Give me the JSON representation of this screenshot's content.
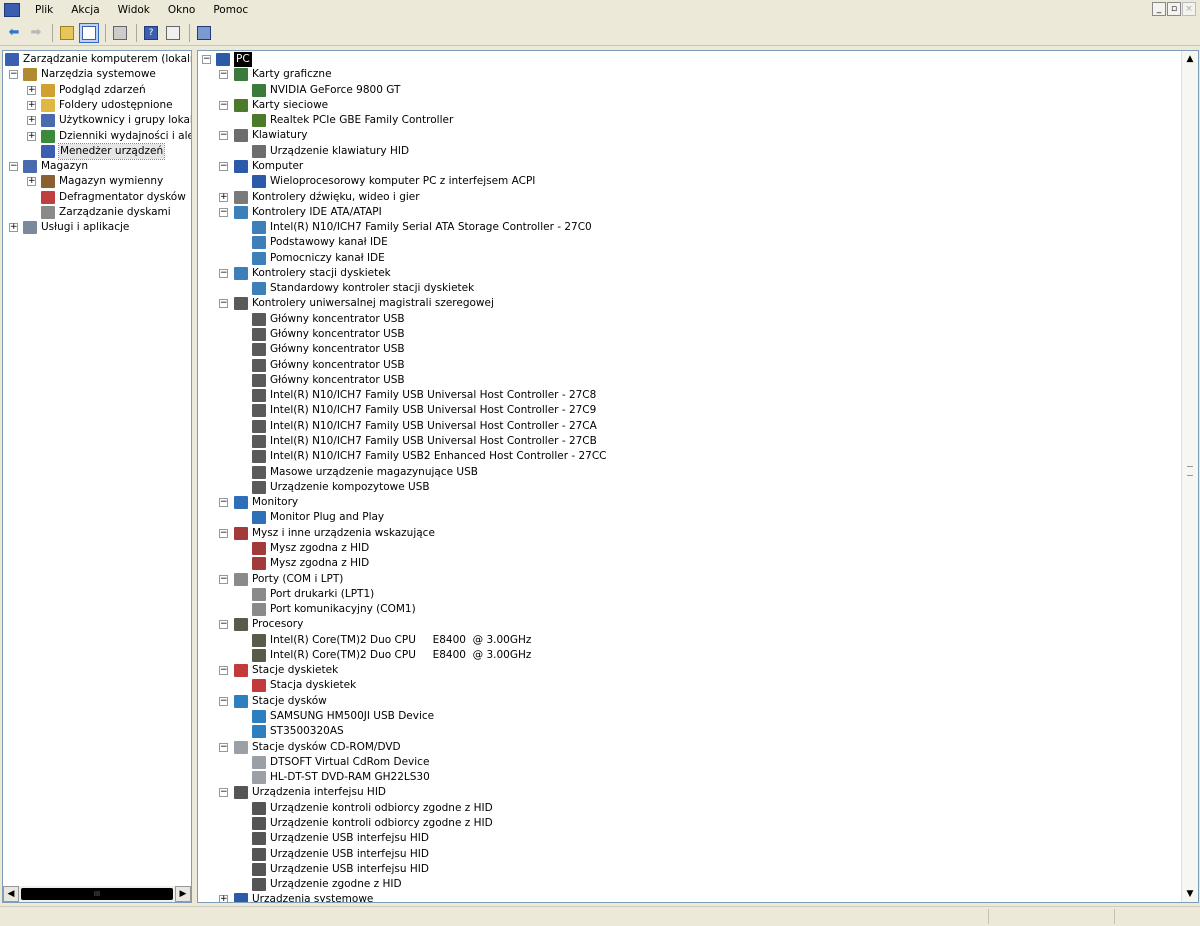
{
  "menubar": {
    "items": [
      "Plik",
      "Akcja",
      "Widok",
      "Okno",
      "Pomoc"
    ],
    "window_controls": [
      "_",
      "▫",
      "×"
    ]
  },
  "toolbar": {
    "buttons": [
      "arrow-left-icon",
      "arrow-right-icon",
      "up-folder-icon",
      "show-tree-icon",
      "print-icon",
      "help-icon",
      "view-icon",
      "properties-icon"
    ]
  },
  "left_tree": {
    "items": [
      {
        "label": "Zarządzanie komputerem (lokalne)",
        "level": 0,
        "icon": "computer-management-icon",
        "expander": ""
      },
      {
        "label": "Narzędzia systemowe",
        "level": 1,
        "icon": "tools-icon",
        "expander": "−"
      },
      {
        "label": "Podgląd zdarzeń",
        "level": 2,
        "icon": "event-viewer-icon",
        "expander": "+"
      },
      {
        "label": "Foldery udostępnione",
        "level": 2,
        "icon": "shared-folder-icon",
        "expander": "+"
      },
      {
        "label": "Użytkownicy i grupy lokalne",
        "level": 2,
        "icon": "users-icon",
        "expander": "+"
      },
      {
        "label": "Dzienniki wydajności i alerty",
        "level": 2,
        "icon": "performance-icon",
        "expander": "+"
      },
      {
        "label": "Menedżer urządzeń",
        "level": 2,
        "icon": "device-manager-icon",
        "expander": "",
        "selected": true
      },
      {
        "label": "Magazyn",
        "level": 1,
        "icon": "storage-icon",
        "expander": "−"
      },
      {
        "label": "Magazyn wymienny",
        "level": 2,
        "icon": "removable-storage-icon",
        "expander": "+"
      },
      {
        "label": "Defragmentator dysków",
        "level": 2,
        "icon": "defrag-icon",
        "expander": ""
      },
      {
        "label": "Zarządzanie dyskami",
        "level": 2,
        "icon": "disk-management-icon",
        "expander": ""
      },
      {
        "label": "Usługi i aplikacje",
        "level": 1,
        "icon": "services-icon",
        "expander": "+"
      }
    ],
    "scroll_thumb": "III"
  },
  "device_tree": {
    "root": "PC",
    "categories": [
      {
        "label": "Karty graficzne",
        "icon": "display-adapter-icon",
        "children": [
          "NVIDIA GeForce 9800 GT"
        ]
      },
      {
        "label": "Karty sieciowe",
        "icon": "network-adapter-icon",
        "children": [
          "Realtek PCIe GBE Family Controller"
        ]
      },
      {
        "label": "Klawiatury",
        "icon": "keyboard-icon",
        "children": [
          "Urządzenie klawiatury HID"
        ]
      },
      {
        "label": "Komputer",
        "icon": "computer-icon",
        "children": [
          "Wieloprocesorowy komputer PC z interfejsem ACPI"
        ]
      },
      {
        "label": "Kontrolery dźwięku, wideo i gier",
        "icon": "sound-icon",
        "children": []
      },
      {
        "label": "Kontrolery IDE ATA/ATAPI",
        "icon": "ide-controller-icon",
        "children": [
          "Intel(R) N10/ICH7 Family Serial ATA Storage Controller - 27C0",
          "Podstawowy kanał IDE",
          "Pomocniczy kanał IDE"
        ]
      },
      {
        "label": "Kontrolery stacji dyskietek",
        "icon": "floppy-controller-icon",
        "children": [
          "Standardowy kontroler stacji dyskietek"
        ]
      },
      {
        "label": "Kontrolery uniwersalnej magistrali szeregowej",
        "icon": "usb-icon",
        "children": [
          "Główny koncentrator USB",
          "Główny koncentrator USB",
          "Główny koncentrator USB",
          "Główny koncentrator USB",
          "Główny koncentrator USB",
          "Intel(R) N10/ICH7 Family USB Universal Host Controller - 27C8",
          "Intel(R) N10/ICH7 Family USB Universal Host Controller - 27C9",
          "Intel(R) N10/ICH7 Family USB Universal Host Controller - 27CA",
          "Intel(R) N10/ICH7 Family USB Universal Host Controller - 27CB",
          "Intel(R) N10/ICH7 Family USB2 Enhanced Host Controller - 27CC",
          "Masowe urządzenie magazynujące USB",
          "Urządzenie kompozytowe USB"
        ]
      },
      {
        "label": "Monitory",
        "icon": "monitor-icon",
        "children": [
          "Monitor Plug and Play"
        ]
      },
      {
        "label": "Mysz i inne urządzenia wskazujące",
        "icon": "mouse-icon",
        "children": [
          "Mysz zgodna z HID",
          "Mysz zgodna z HID"
        ]
      },
      {
        "label": "Porty (COM i LPT)",
        "icon": "port-icon",
        "children": [
          "Port drukarki (LPT1)",
          "Port komunikacyjny (COM1)"
        ]
      },
      {
        "label": "Procesory",
        "icon": "processor-icon",
        "children": [
          "Intel(R) Core(TM)2 Duo CPU     E8400  @ 3.00GHz",
          "Intel(R) Core(TM)2 Duo CPU     E8400  @ 3.00GHz"
        ]
      },
      {
        "label": "Stacje dyskietek",
        "icon": "floppy-drive-icon",
        "children": [
          "Stacja dyskietek"
        ]
      },
      {
        "label": "Stacje dysków",
        "icon": "disk-drive-icon",
        "children": [
          "SAMSUNG HM500JI USB Device",
          "ST3500320AS"
        ]
      },
      {
        "label": "Stacje dysków CD-ROM/DVD",
        "icon": "cdrom-icon",
        "children": [
          "DTSOFT Virtual CdRom Device",
          "HL-DT-ST DVD-RAM GH22LS30"
        ]
      },
      {
        "label": "Urządzenia interfejsu HID",
        "icon": "hid-icon",
        "children": [
          "Urządzenie kontroli odbiorcy zgodne z HID",
          "Urządzenie kontroli odbiorcy zgodne z HID",
          "Urządzenie USB interfejsu HID",
          "Urządzenie USB interfejsu HID",
          "Urządzenie USB interfejsu HID",
          "Urządzenie zgodne z HID"
        ]
      },
      {
        "label": "Urządzenia systemowe",
        "icon": "system-device-icon",
        "children": []
      }
    ]
  },
  "icon_colors": {
    "display-adapter-icon": "#3a7a3a",
    "network-adapter-icon": "#4b7a2b",
    "keyboard-icon": "#6d6d6d",
    "computer-icon": "#2b5aa8",
    "sound-icon": "#7a7a7a",
    "ide-controller-icon": "#3d7fb8",
    "floppy-controller-icon": "#3d7fb8",
    "usb-icon": "#5a5a5a",
    "monitor-icon": "#2f6fb8",
    "mouse-icon": "#a33a3a",
    "port-icon": "#8a8a8a",
    "processor-icon": "#5a5a4a",
    "floppy-drive-icon": "#c23a3a",
    "disk-drive-icon": "#2e7fc0",
    "cdrom-icon": "#9aa0a6",
    "hid-icon": "#555555",
    "system-device-icon": "#2b5aa8"
  },
  "left_icon_colors": {
    "computer-management-icon": "#3b5fb0",
    "tools-icon": "#b08a30",
    "event-viewer-icon": "#d0a030",
    "shared-folder-icon": "#e0b840",
    "users-icon": "#4a6ab0",
    "performance-icon": "#3a8a3a",
    "device-manager-icon": "#3b5fb0",
    "storage-icon": "#4a6ab0",
    "removable-storage-icon": "#8a6030",
    "defrag-icon": "#c04040",
    "disk-management-icon": "#8a8a8a",
    "services-icon": "#7a8a9a"
  }
}
